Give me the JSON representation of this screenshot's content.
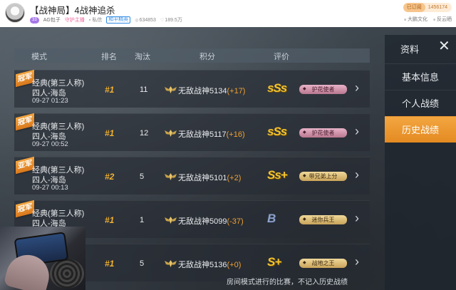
{
  "header": {
    "title": "【战神局】4战神追杀",
    "level_badge": "33",
    "streamer": "AG包子",
    "guard_link": "守护主播",
    "pm_link": "私信",
    "category": "和平精英",
    "popularity": "634853",
    "fans": "189.5万",
    "followed_label": "已订阅",
    "follow_count": "1456174",
    "links": [
      "大鹏文化",
      "反云晒"
    ]
  },
  "table": {
    "headers": [
      "模式",
      "排名",
      "淘汰",
      "积分",
      "评价"
    ],
    "rows": [
      {
        "ribbon": "冠军",
        "mode": "经典(第三人称)",
        "players": "四人-海岛",
        "time": "09-27 01:23",
        "rank": "#1",
        "kills": "11",
        "score_prefix": "无敌战神",
        "score": "5134",
        "delta": "(+17)",
        "grade": "sSs",
        "badge": "护花使者",
        "badge_style": "pink"
      },
      {
        "ribbon": "冠军",
        "mode": "经典(第三人称)",
        "players": "四人-海岛",
        "time": "09-27 00:52",
        "rank": "#1",
        "kills": "12",
        "score_prefix": "无敌战神",
        "score": "5117",
        "delta": "(+16)",
        "grade": "sSs",
        "badge": "护花使者",
        "badge_style": "pink"
      },
      {
        "ribbon": "亚军",
        "mode": "经典(第三人称)",
        "players": "四人-海岛",
        "time": "09-27 00:13",
        "rank": "#2",
        "kills": "5",
        "score_prefix": "无敌战神",
        "score": "5101",
        "delta": "(+2)",
        "grade": "Ss+",
        "badge": "带兄弟上分",
        "badge_style": "gold"
      },
      {
        "ribbon": "冠军",
        "mode": "经典(第三人称)",
        "players": "四人-海岛",
        "time": "",
        "rank": "#1",
        "kills": "1",
        "score_prefix": "无敌战神",
        "score": "5099",
        "delta": "(-37)",
        "grade": "B",
        "badge": "迷你兵王",
        "badge_style": "gold"
      },
      {
        "ribbon": "",
        "mode": "",
        "players": "",
        "time": "",
        "rank": "#1",
        "kills": "5",
        "score_prefix": "无敌战神",
        "score": "5136",
        "delta": "(+0)",
        "grade": "S+",
        "badge": "战地之王",
        "badge_style": "gold"
      }
    ]
  },
  "side_panel": {
    "title": "资料",
    "close_glyph": "✕",
    "items": [
      "基本信息",
      "个人战绩",
      "历史战绩"
    ],
    "active_index": 2
  },
  "footer_note": "房间模式进行的比赛，不记入历史战绩",
  "colors": {
    "accent_orange": "#e48a22",
    "rank_gold": "#f0b030",
    "grade_gold": "#f3c330",
    "delta_orange": "#f0a030"
  }
}
